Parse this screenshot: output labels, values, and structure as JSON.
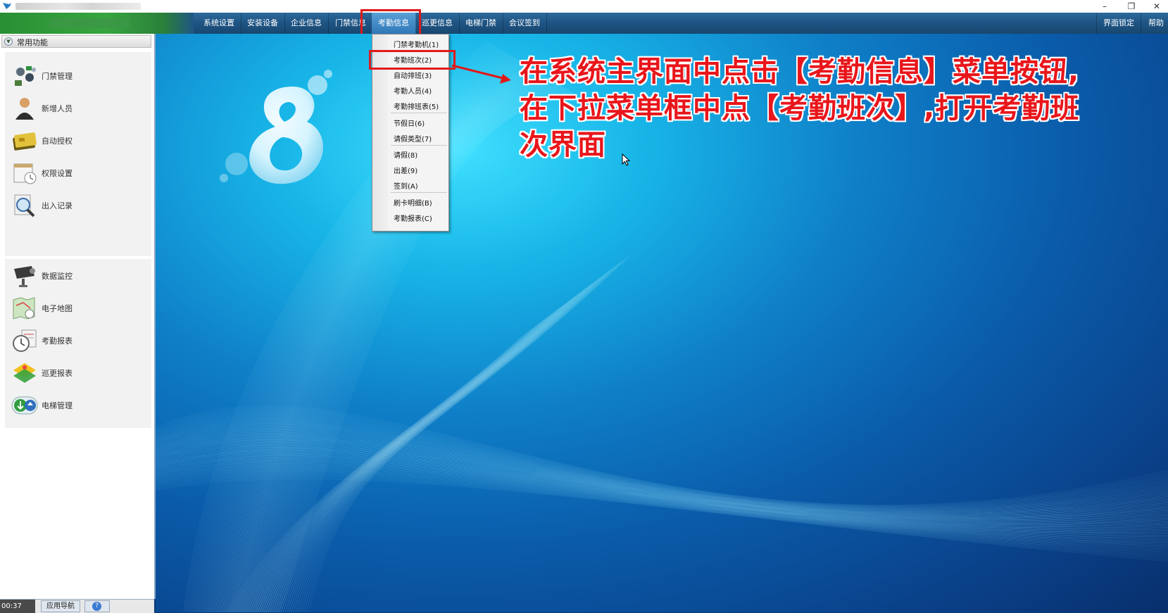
{
  "titlebar": {
    "minimize": "–",
    "restore": "❐",
    "close": "✕"
  },
  "menubar": {
    "items": [
      {
        "label": "系统设置"
      },
      {
        "label": "安装设备"
      },
      {
        "label": "企业信息"
      },
      {
        "label": "门禁信息"
      },
      {
        "label": "考勤信息",
        "active": true
      },
      {
        "label": "巡更信息"
      },
      {
        "label": "电梯门禁"
      },
      {
        "label": "会议签到"
      }
    ],
    "right_items": [
      {
        "label": "界面锁定"
      },
      {
        "label": "帮助"
      }
    ]
  },
  "left_panel": {
    "header": "常用功能",
    "group1": [
      {
        "label": "门禁管理",
        "icon": "access-control-icon"
      },
      {
        "label": "新增人员",
        "icon": "person-icon"
      },
      {
        "label": "自动授权",
        "icon": "card-icon"
      },
      {
        "label": "权限设置",
        "icon": "calendar-clock-icon"
      },
      {
        "label": "出入记录",
        "icon": "magnifier-icon"
      }
    ],
    "group2": [
      {
        "label": "数据监控",
        "icon": "camera-icon"
      },
      {
        "label": "电子地图",
        "icon": "map-icon"
      },
      {
        "label": "考勤报表",
        "icon": "clock-icon"
      },
      {
        "label": "巡更报表",
        "icon": "patrol-icon"
      },
      {
        "label": "电梯管理",
        "icon": "elevator-icon"
      }
    ],
    "bottom": {
      "time": "00:37",
      "nav_tab": "应用导航",
      "help": "?"
    }
  },
  "dropdown": {
    "items": [
      "门禁考勤机(1)",
      "考勤班次(2)",
      "自动排班(3)",
      "考勤人员(4)",
      "考勤排班表(5)",
      "节假日(6)",
      "请假类型(7)",
      "请假(8)",
      "出差(9)",
      "签到(A)",
      "刷卡明细(B)",
      "考勤报表(C)"
    ]
  },
  "annotation": {
    "text": "在系统主界面中点击【考勤信息】菜单按钮,在下拉菜单框中点【考勤班次】,打开考勤班次界面"
  },
  "colors": {
    "highlight_red": "#e01a1a",
    "annotation_red": "#e8161b",
    "menubar_blue": "#1f5585",
    "brand_green": "#37a53f"
  }
}
